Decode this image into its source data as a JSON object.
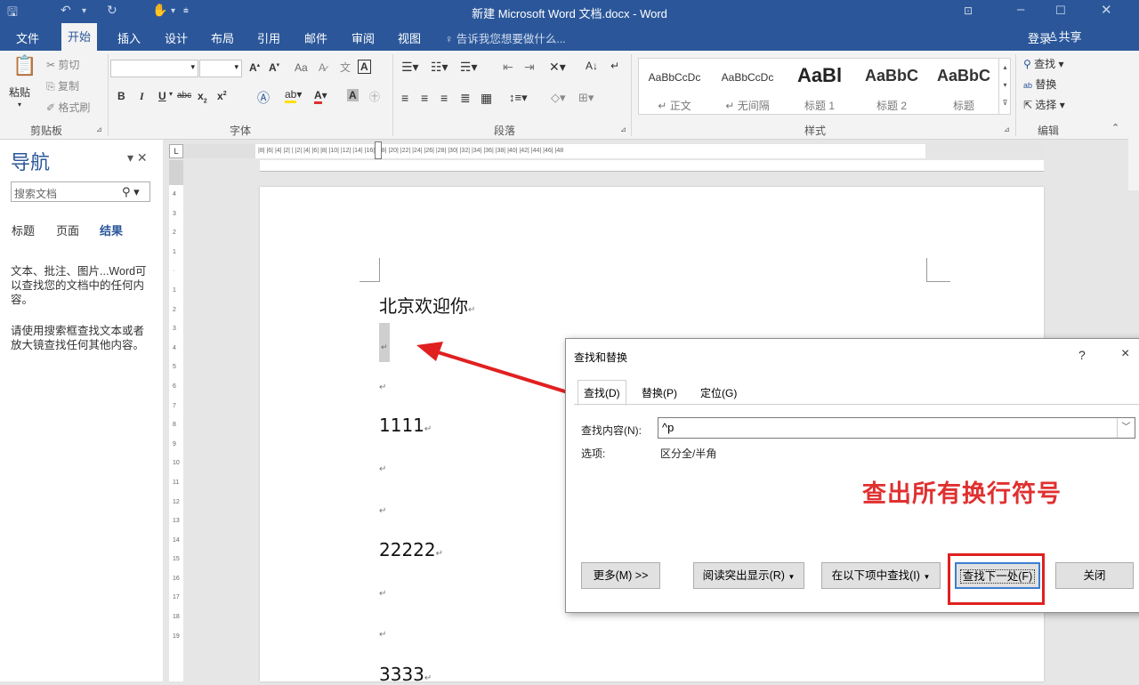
{
  "window": {
    "title": "新建 Microsoft Word 文档.docx - Word"
  },
  "tabs": {
    "file": "文件",
    "home": "开始",
    "insert": "插入",
    "design": "设计",
    "layout": "布局",
    "references": "引用",
    "mailings": "邮件",
    "review": "审阅",
    "view": "视图",
    "tell_me": "告诉我您想要做什么...",
    "login": "登录",
    "share": "共享"
  },
  "ribbon": {
    "clipboard": {
      "paste": "粘贴",
      "cut": "剪切",
      "copy": "复制",
      "format_painter": "格式刷",
      "label": "剪贴板"
    },
    "font": {
      "label": "字体",
      "case_btn": "Aa"
    },
    "paragraph": {
      "label": "段落"
    },
    "styles": {
      "label": "样式",
      "items": [
        {
          "preview": "AaBbCcDc",
          "name": "正文"
        },
        {
          "preview": "AaBbCcDc",
          "name": "无间隔"
        },
        {
          "preview": "AaBl",
          "name": "标题 1"
        },
        {
          "preview": "AaBbC",
          "name": "标题 2"
        },
        {
          "preview": "AaBbC",
          "name": "标题"
        }
      ]
    },
    "editing": {
      "find": "查找",
      "replace": "替换",
      "select": "选择",
      "label": "编辑"
    }
  },
  "nav": {
    "title": "导航",
    "search_placeholder": "搜索文档",
    "tab_headings": "标题",
    "tab_pages": "页面",
    "tab_results": "结果",
    "text1": "文本、批注、图片...Word可以查找您的文档中的任何内容。",
    "text2": "请使用搜索框查找文本或者放大镜查找任何其他内容。"
  },
  "ruler": {
    "h_ticks": "|8|  |6|  |4|  |2|   |  |2|  |4|  |6|  |8|  |10|  |12|  |14|  |16|  |18|  |20|  |22|  |24|  |26|  |28|  |30|  |32|  |34|  |36|  |38|  |40|  |42|  |44|  |46|  |48",
    "corner": "L"
  },
  "document": {
    "line1": "北京欢迎你",
    "line2": "1111",
    "line3": "22222",
    "line4": "3333",
    "para_mark": "↵"
  },
  "dialog": {
    "title": "查找和替换",
    "help": "?",
    "close": "×",
    "tab_find": "查找(D)",
    "tab_replace": "替换(P)",
    "tab_goto": "定位(G)",
    "find_label": "查找内容(N):",
    "find_value": "^p",
    "options_label": "选项:",
    "options_value": "区分全/半角",
    "more_btn": "更多(M) >>",
    "reading_highlight_btn": "阅读突出显示(R)",
    "find_in_btn": "在以下项中查找(I)",
    "find_next_btn": "查找下一处(F)",
    "close_btn": "关闭"
  },
  "annotation": {
    "text": "查出所有换行符号",
    "color": "#e03030"
  },
  "colors": {
    "brand": "#2b579a",
    "highlight_red": "#e02020"
  }
}
